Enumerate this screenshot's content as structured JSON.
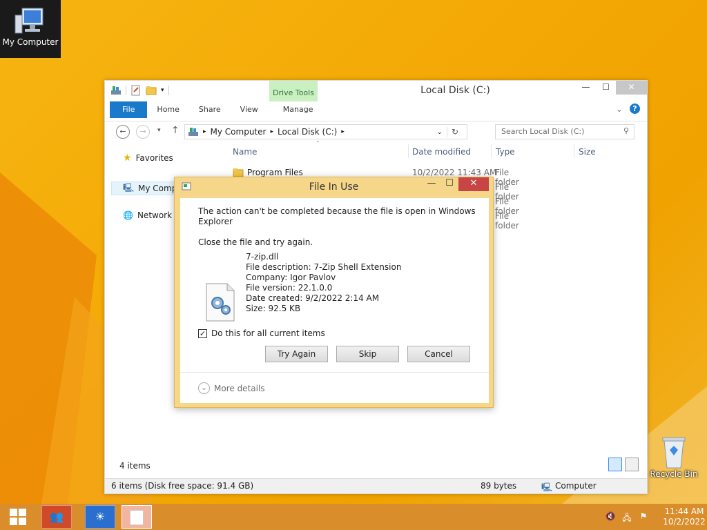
{
  "desktop": {
    "my_computer_label": "My Computer",
    "recycle_bin_label": "Recycle Bin"
  },
  "explorer": {
    "title": "Local Disk (C:)",
    "contextual_tab": "Drive Tools",
    "ribbon_tabs": [
      "File",
      "Home",
      "Share",
      "View",
      "Manage"
    ],
    "address": {
      "crumbs": [
        "My Computer",
        "Local Disk (C:)"
      ]
    },
    "search_placeholder": "Search Local Disk (C:)",
    "nav": {
      "favorites": "Favorites",
      "my_computer": "My Comp",
      "network": "Network"
    },
    "columns": [
      "Name",
      "Date modified",
      "Type",
      "Size"
    ],
    "rows": [
      {
        "name": "Program Files",
        "date": "10/2/2022 11:43 AM",
        "type": "File folder"
      },
      {
        "name": "",
        "date": "",
        "type": "File folder"
      },
      {
        "name": "",
        "date": "",
        "type": "File folder"
      },
      {
        "name": "",
        "date": "",
        "type": "File folder"
      }
    ],
    "item_count": "4 items",
    "status": {
      "left": "6 items (Disk free space: 91.4 GB)",
      "mid": "89 bytes",
      "right": "Computer"
    }
  },
  "dialog": {
    "title": "File In Use",
    "message_line1": "The action can't be completed because the file is open in Windows",
    "message_line2": "Explorer",
    "instruction": "Close the file and try again.",
    "file": {
      "name": "7-zip.dll",
      "description": "File description: 7-Zip Shell Extension",
      "company": "Company: Igor Pavlov",
      "version": "File version: 22.1.0.0",
      "created": "Date created: 9/2/2022 2:14 AM",
      "size": "Size: 92.5 KB"
    },
    "checkbox_label": "Do this for all current items",
    "checkbox_checked": true,
    "buttons": {
      "try_again": "Try Again",
      "skip": "Skip",
      "cancel": "Cancel"
    },
    "more_details": "More details"
  },
  "taskbar": {
    "time": "11:44 AM",
    "date": "10/2/2022"
  },
  "colors": {
    "accent": "#1979ca",
    "dialog_frame": "#f6d78a",
    "close_red": "#c74545",
    "taskbar": "#d98d2b"
  }
}
